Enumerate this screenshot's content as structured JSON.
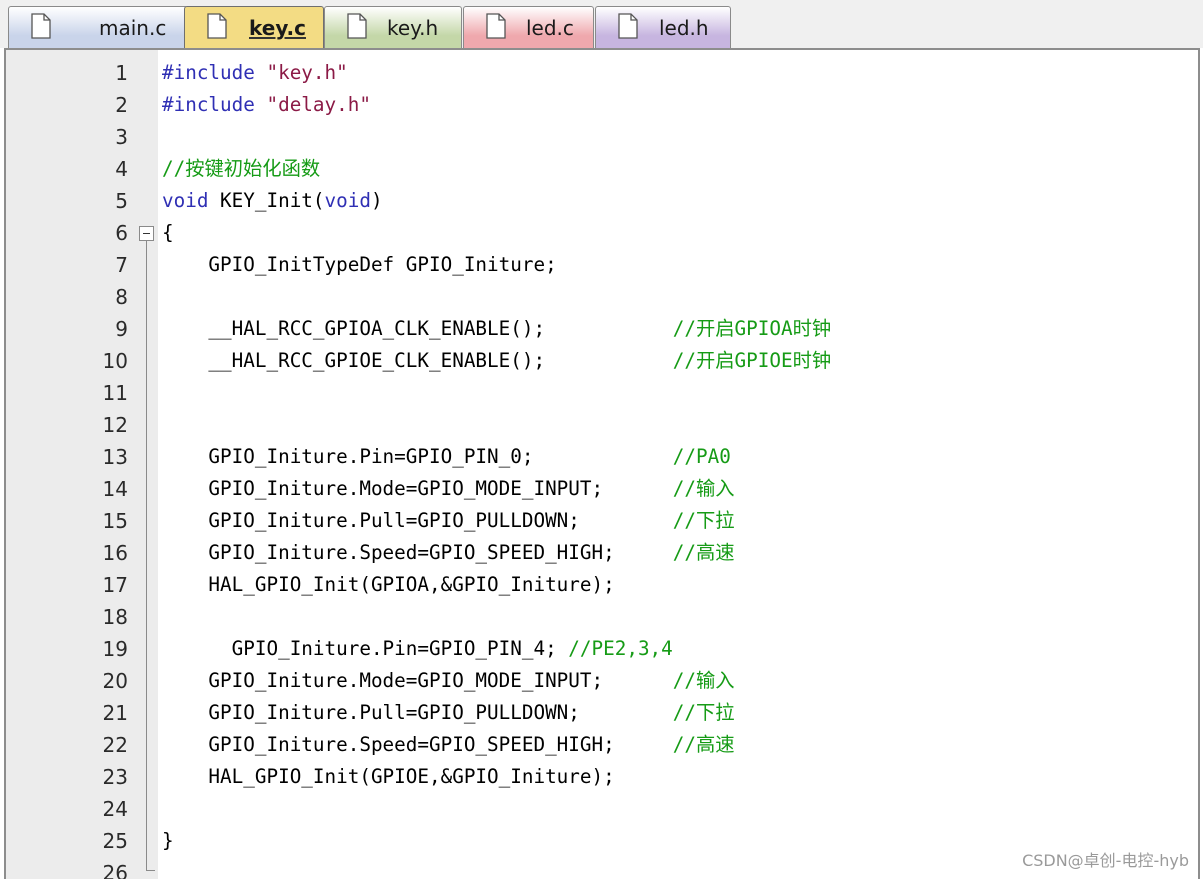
{
  "tabs": [
    {
      "label": "main.c",
      "active": false,
      "color": "#c9d4ea"
    },
    {
      "label": "key.c",
      "active": true,
      "color": "#f3dc84"
    },
    {
      "label": "key.h",
      "active": false,
      "color": "#c4d7a8"
    },
    {
      "label": "led.c",
      "active": false,
      "color": "#efa8ad"
    },
    {
      "label": "led.h",
      "active": false,
      "color": "#c7b5e0"
    }
  ],
  "editor": {
    "lines": [
      {
        "n": "1",
        "code": "#include \"key.h\""
      },
      {
        "n": "2",
        "code": "#include \"delay.h\""
      },
      {
        "n": "3",
        "code": ""
      },
      {
        "n": "4",
        "code": "//按键初始化函数"
      },
      {
        "n": "5",
        "code": "void KEY_Init(void)"
      },
      {
        "n": "6",
        "code": "{"
      },
      {
        "n": "7",
        "code": "    GPIO_InitTypeDef GPIO_Initure;"
      },
      {
        "n": "8",
        "code": ""
      },
      {
        "n": "9",
        "code": "    __HAL_RCC_GPIOA_CLK_ENABLE();           //开启GPIOA时钟"
      },
      {
        "n": "10",
        "code": "    __HAL_RCC_GPIOE_CLK_ENABLE();           //开启GPIOE时钟"
      },
      {
        "n": "11",
        "code": ""
      },
      {
        "n": "12",
        "code": ""
      },
      {
        "n": "13",
        "code": "    GPIO_Initure.Pin=GPIO_PIN_0;            //PA0"
      },
      {
        "n": "14",
        "code": "    GPIO_Initure.Mode=GPIO_MODE_INPUT;      //输入"
      },
      {
        "n": "15",
        "code": "    GPIO_Initure.Pull=GPIO_PULLDOWN;        //下拉"
      },
      {
        "n": "16",
        "code": "    GPIO_Initure.Speed=GPIO_SPEED_HIGH;     //高速"
      },
      {
        "n": "17",
        "code": "    HAL_GPIO_Init(GPIOA,&GPIO_Initure);"
      },
      {
        "n": "18",
        "code": ""
      },
      {
        "n": "19",
        "code": "      GPIO_Initure.Pin=GPIO_PIN_4; //PE2,3,4"
      },
      {
        "n": "20",
        "code": "    GPIO_Initure.Mode=GPIO_MODE_INPUT;      //输入"
      },
      {
        "n": "21",
        "code": "    GPIO_Initure.Pull=GPIO_PULLDOWN;        //下拉"
      },
      {
        "n": "22",
        "code": "    GPIO_Initure.Speed=GPIO_SPEED_HIGH;     //高速"
      },
      {
        "n": "23",
        "code": "    HAL_GPIO_Init(GPIOE,&GPIO_Initure);"
      },
      {
        "n": "24",
        "code": ""
      },
      {
        "n": "25",
        "code": "}"
      },
      {
        "n": "26",
        "code": ""
      }
    ]
  },
  "watermark": "CSDN@卓创-电控-hyb",
  "colors": {
    "keyword": "#2f2fb4",
    "string": "#8b1a46",
    "comment": "#169b16"
  }
}
